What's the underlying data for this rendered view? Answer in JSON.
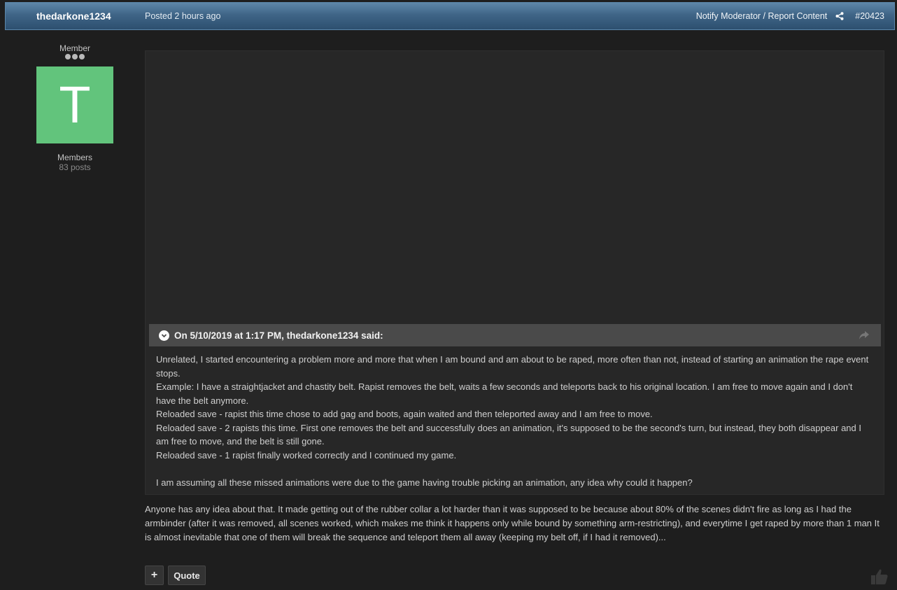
{
  "header": {
    "author": "thedarkone1234",
    "posted": "Posted 2 hours ago",
    "report": "Notify Moderator / Report Content",
    "post_number": "#20423",
    "share_icon": "share-icon"
  },
  "author": {
    "title": "Member",
    "avatar_letter": "T",
    "avatar_color": "#62c47c",
    "group": "Members",
    "posts": "83 posts"
  },
  "quote": {
    "citation": "On 5/10/2019 at 1:17 PM, thedarkone1234 said:",
    "lines": [
      "Unrelated, I started encountering a problem more and more that when I am bound and am about to be raped, more often than not, instead of starting an animation the rape event stops.",
      "Example: I have a straightjacket and chastity belt. Rapist removes the belt, waits a few seconds and teleports back to his original location. I am free to move again and I don't have the belt anymore.",
      "Reloaded save - rapist this time chose to add gag and boots, again waited and then teleported away and I am free to move.",
      "Reloaded save - 2 rapists this time. First one removes the belt and successfully does an animation, it's supposed to be the second's turn, but instead, they both disappear and I am free to move, and the belt is still gone.",
      "Reloaded save - 1 rapist finally worked correctly and I continued my game."
    ],
    "closing": "I am assuming all these missed animations were due to the game having trouble picking an animation, any idea why could it happen?"
  },
  "reply": "Anyone has any idea about that. It made getting out of the rubber collar a lot harder than it was supposed to be because about 80% of the scenes didn't fire as long as I had the armbinder (after it was removed, all scenes worked, which makes me think it happens only while bound by something arm-restricting), and everytime I get raped by more than 1 man It is almost inevitable that one of them will break the sequence and teleport them all away (keeping my belt off, if I had it removed)...",
  "actions": {
    "plus_label": "+",
    "quote_label": "Quote"
  },
  "colors": {
    "header_bg": "#3f6587",
    "page_bg": "#1e1e1e",
    "quote_header_bg": "#4a4a4a"
  }
}
